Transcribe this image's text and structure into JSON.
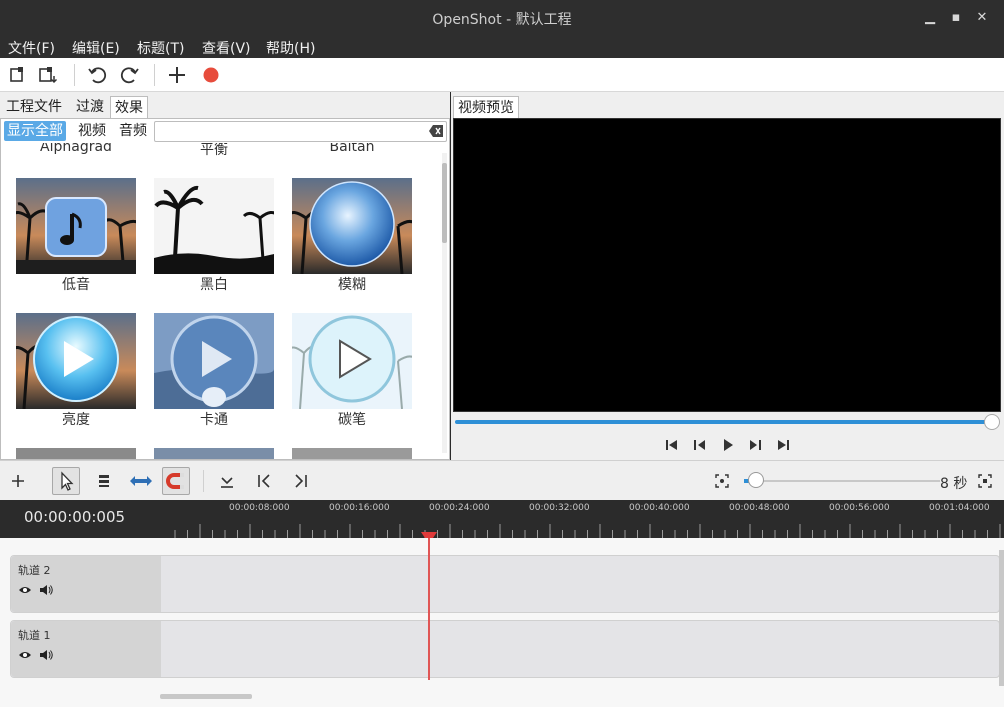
{
  "window": {
    "title": "OpenShot - 默认工程"
  },
  "menu": [
    "文件(F)",
    "编辑(E)",
    "标题(T)",
    "查看(V)",
    "帮助(H)"
  ],
  "toolbar": {
    "icons": [
      "new-project-icon",
      "import-icon",
      "undo-icon",
      "redo-icon",
      "add-icon",
      "record-icon"
    ]
  },
  "left_tabs": [
    "工程文件",
    "过渡",
    "效果"
  ],
  "filter": {
    "buttons": [
      "显示全部",
      "视频",
      "音频"
    ],
    "search_value": ""
  },
  "effects": {
    "row0": [
      "Alphagrad",
      "平衡",
      "Baltan"
    ],
    "row1": [
      "低音",
      "黑白",
      "模糊"
    ],
    "row2": [
      "亮度",
      "卡通",
      "碳笔"
    ]
  },
  "preview": {
    "tab": "视频预览",
    "progress": 1.0
  },
  "timeline": {
    "zoom_label": "8 秒",
    "timecode": "00:00:00:005",
    "ticks": [
      "00:00:08:000",
      "00:00:16:000",
      "00:00:24:000",
      "00:00:32:000",
      "00:00:40:000",
      "00:00:48:000",
      "00:00:56:000",
      "00:01:04:000"
    ],
    "tracks": [
      "轨道 2",
      "轨道 1"
    ]
  },
  "colors": {
    "accent": "#2e8fd6",
    "record": "#e74c3c",
    "playhead": "#e05555"
  }
}
